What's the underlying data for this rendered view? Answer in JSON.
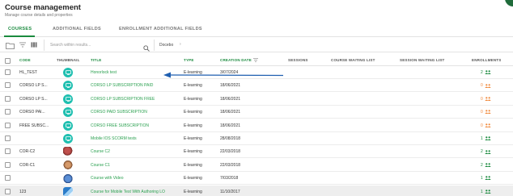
{
  "header": {
    "title": "Course management",
    "subtitle": "Manage course details and properties"
  },
  "tabs": [
    {
      "label": "COURSES",
      "active": true
    },
    {
      "label": "ADDITIONAL FIELDS",
      "active": false
    },
    {
      "label": "ENROLLMENT ADDITIONAL FIELDS",
      "active": false
    }
  ],
  "toolbar": {
    "search_placeholder": "Search within results...",
    "breadcrumb": "Docebo",
    "icons": [
      "folder-icon",
      "filter-icon",
      "columns-icon",
      "search-icon",
      "chevron-right-icon"
    ]
  },
  "table": {
    "columns": [
      "CODE",
      "THUMBNAIL",
      "TITLE",
      "TYPE",
      "CREATION DATE",
      "SESSIONS",
      "COURSE WAITING LIST",
      "SESSION WAITING LIST",
      "ENROLLMENTS"
    ],
    "sorted_column": "CREATION DATE",
    "rows": [
      {
        "code": "HL_TEST",
        "thumb": "teal",
        "title": "Honorlock test",
        "type": "E-learning",
        "date": "3/07/2024",
        "enrollments": "2",
        "enr_color": "green"
      },
      {
        "code": "CORSO LP S...",
        "thumb": "teal",
        "title": "CORSO LP SUBSCRIPTION PAID",
        "type": "E-learning",
        "date": "18/06/2021",
        "enrollments": "0",
        "enr_color": "orange"
      },
      {
        "code": "CORSO LP S...",
        "thumb": "teal",
        "title": "CORSO LP SUBSCRIPTION FREE",
        "type": "E-learning",
        "date": "18/06/2021",
        "enrollments": "0",
        "enr_color": "orange"
      },
      {
        "code": "CORSO PAI...",
        "thumb": "teal",
        "title": "CORSO PAID SUBSCRIPTION",
        "type": "E-learning",
        "date": "18/06/2021",
        "enrollments": "0",
        "enr_color": "orange"
      },
      {
        "code": "FREE SUBSC...",
        "thumb": "teal",
        "title": "CORSO FREE SUBSCRIPTION",
        "type": "E-learning",
        "date": "18/06/2021",
        "enrollments": "0",
        "enr_color": "orange"
      },
      {
        "code": "",
        "thumb": "teal",
        "title": "Mobile IOS SCORM tests",
        "type": "E-learning",
        "date": "28/08/2018",
        "enrollments": "1",
        "enr_color": "green"
      },
      {
        "code": "COR-C2",
        "thumb": "photo-a",
        "title": "Course C2",
        "type": "E-learning",
        "date": "22/03/2018",
        "enrollments": "2",
        "enr_color": "green"
      },
      {
        "code": "COR-C1",
        "thumb": "photo-b",
        "title": "Course C1",
        "type": "E-learning",
        "date": "22/03/2018",
        "enrollments": "2",
        "enr_color": "green"
      },
      {
        "code": "",
        "thumb": "photo-c",
        "title": "Course with Video",
        "type": "E-learning",
        "date": "7/03/2018",
        "enrollments": "1",
        "enr_color": "green"
      },
      {
        "code": "123",
        "thumb": "photo-d",
        "title": "Course for Mobile Test With Authoring LO",
        "type": "E-learning",
        "date": "11/10/2017",
        "enrollments": "1",
        "enr_color": "green",
        "highlighted": true
      }
    ]
  },
  "colors": {
    "accent": "#1a8a3e",
    "link": "#2aa04f",
    "thumb_teal": "#1fbfb0",
    "enr_orange": "#f0883a",
    "arrow": "#1f5fb0"
  }
}
